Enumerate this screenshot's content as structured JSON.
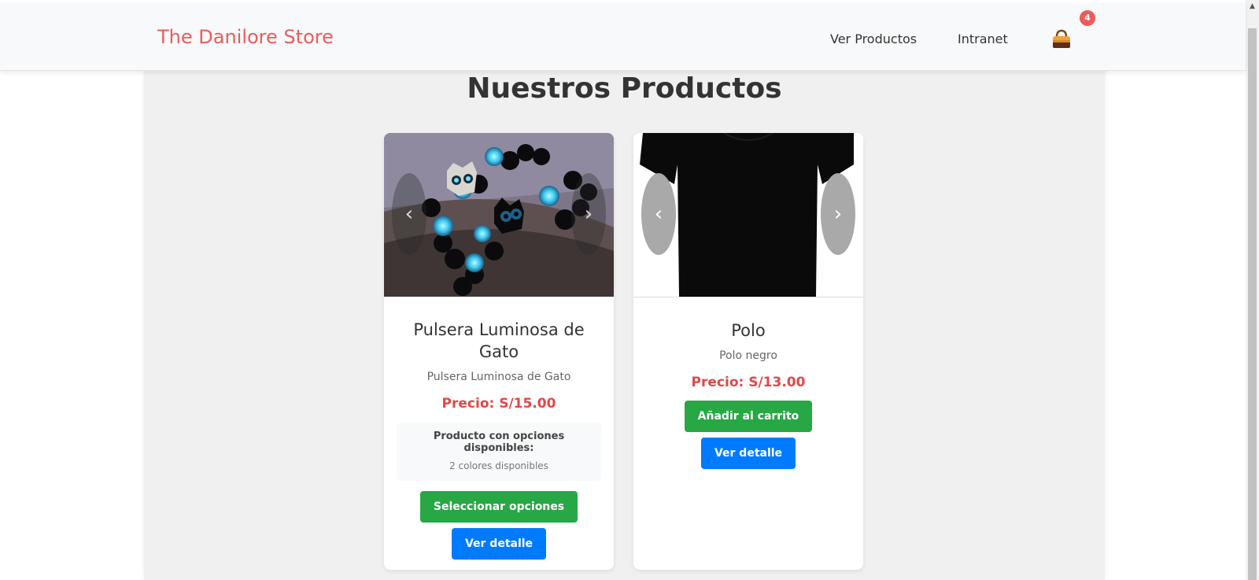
{
  "navbar": {
    "brand": "The Danilore Store",
    "links": [
      "Ver Productos",
      "Intranet"
    ],
    "cart_count": "4"
  },
  "main": {
    "title": "Nuestros Productos",
    "products": [
      {
        "name": "Pulsera Luminosa de Gato",
        "description": "Pulsera Luminosa de Gato",
        "price": "Precio: S/15.00",
        "options_title": "Producto con opciones disponibles:",
        "options_count": "2 colores disponibles",
        "primary_button": "Seleccionar opciones",
        "detail_button": "Ver detalle"
      },
      {
        "name": "Polo",
        "description": "Polo negro",
        "price": "Precio: S/13.00",
        "primary_button": "Añadir al carrito",
        "detail_button": "Ver detalle"
      }
    ]
  },
  "icons": {
    "carousel_prev": "‹",
    "carousel_next": "›",
    "cart_icon": "shopping-bag-icon"
  },
  "colors": {
    "brand": "#ec5b5b",
    "price": "#e04848",
    "green_button": "#28a745",
    "blue_button": "#007bff",
    "badge": "#f15a5a"
  }
}
